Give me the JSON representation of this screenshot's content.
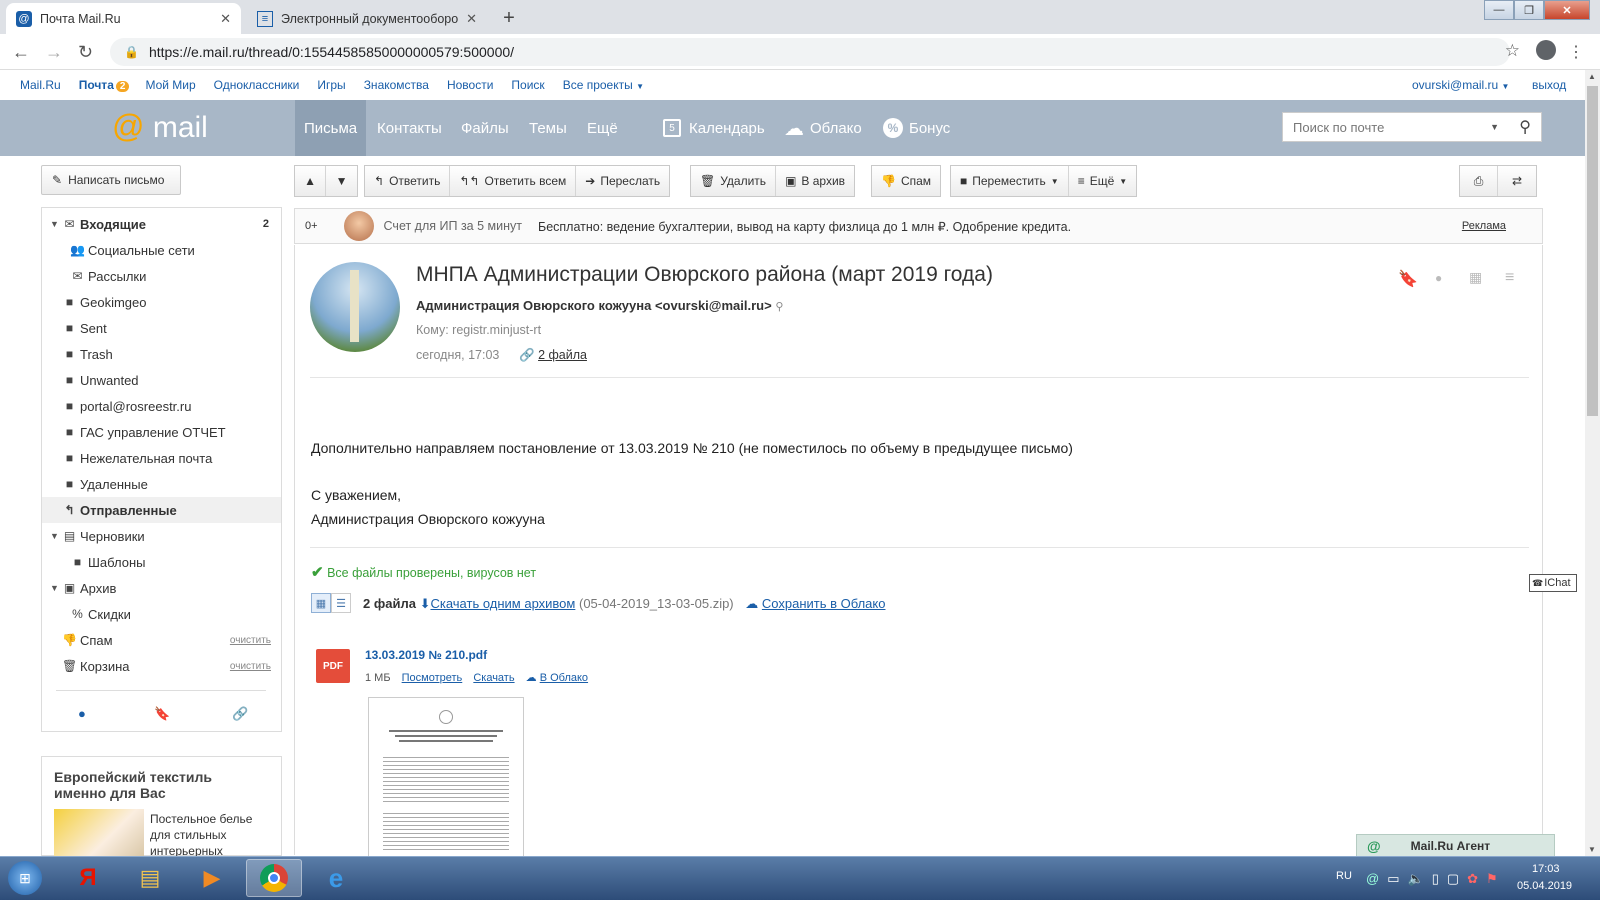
{
  "browser": {
    "tabs": [
      {
        "title": "Почта Mail.Ru",
        "active": true
      },
      {
        "title": "Электронный документооборо",
        "active": false
      }
    ],
    "new_tab": "+",
    "url": "https://e.mail.ru/thread/0:15544585850000000579:500000/"
  },
  "portal": {
    "links": [
      "Mail.Ru",
      "Почта",
      "Мой Мир",
      "Одноклассники",
      "Игры",
      "Знакомства",
      "Новости",
      "Поиск",
      "Все проекты"
    ],
    "mail_badge": "2",
    "user": "ovurski@mail.ru",
    "logout": "выход"
  },
  "header": {
    "logo": "mail",
    "nav": [
      "Письма",
      "Контакты",
      "Файлы",
      "Темы",
      "Ещё"
    ],
    "services": [
      "Календарь",
      "Облако",
      "Бонус"
    ],
    "calendar_day": "5",
    "search_placeholder": "Поиск по почте"
  },
  "compose": "Написать письмо",
  "folders": [
    {
      "name": "Входящие",
      "count": "2",
      "level": 0,
      "arrow": "▼",
      "icon": "inbox-icon"
    },
    {
      "name": "Социальные сети",
      "level": 1,
      "icon": "people-icon"
    },
    {
      "name": "Рассылки",
      "level": 1,
      "icon": "newsletter-icon"
    },
    {
      "name": "Geokimgeo",
      "level": 0,
      "icon": "folder-icon"
    },
    {
      "name": "Sent",
      "level": 0,
      "icon": "folder-icon"
    },
    {
      "name": "Trash",
      "level": 0,
      "icon": "folder-icon"
    },
    {
      "name": "Unwanted",
      "level": 0,
      "icon": "folder-icon"
    },
    {
      "name": "portal@rosreestr.ru",
      "level": 0,
      "icon": "folder-icon"
    },
    {
      "name": "ГАС управление ОТЧЕТ",
      "level": 0,
      "icon": "folder-icon"
    },
    {
      "name": "Нежелательная почта",
      "level": 0,
      "icon": "folder-icon"
    },
    {
      "name": "Удаленные",
      "level": 0,
      "icon": "folder-icon"
    },
    {
      "name": "Отправленные",
      "level": 0,
      "icon": "sent-icon",
      "selected": true
    },
    {
      "name": "Черновики",
      "level": 0,
      "arrow": "▼",
      "icon": "drafts-icon"
    },
    {
      "name": "Шаблоны",
      "level": 1,
      "icon": "folder-icon"
    },
    {
      "name": "Архив",
      "level": 0,
      "arrow": "▼",
      "icon": "archive-icon"
    },
    {
      "name": "Скидки",
      "level": 1,
      "icon": "discount-icon"
    },
    {
      "name": "Спам",
      "level": 0,
      "icon": "spam-icon",
      "clear": "очистить"
    },
    {
      "name": "Корзина",
      "level": 0,
      "icon": "trash-icon",
      "clear": "очистить"
    }
  ],
  "left_ad": {
    "title": "Европейский текстиль именно для Вас",
    "text": "Постельное белье для стильных интерьерных"
  },
  "toolbar": {
    "reply": "Ответить",
    "reply_all": "Ответить всем",
    "forward": "Переслать",
    "delete": "Удалить",
    "archive": "В архив",
    "spam": "Спам",
    "move": "Переместить",
    "more": "Ещё"
  },
  "ad_bar": {
    "age": "0+",
    "title": "Счет для ИП за 5 минут",
    "text": "Бесплатно: ведение бухгалтерии, вывод на карту физлица до 1 млн ₽. Одобрение кредита.",
    "label": "Реклама"
  },
  "message": {
    "subject": "МНПА Администрации Овюрского района (март 2019 года)",
    "from": "Администрация Овюрского кожууна <ovurski@mail.ru>",
    "to": "Кому: registr.minjust-rt",
    "date": "сегодня, 17:03",
    "files_link": "2 файла",
    "body1": "Дополнительно направляем постановление от 13.03.2019 № 210 (не поместилось по объему в предыдущее письмо)",
    "body2": "С уважением,",
    "body3": "Администрация Овюрского кожууна",
    "virus": "Все файлы проверены, вирусов нет",
    "files_count": "2 файла",
    "download_archive": "Скачать одним архивом",
    "archive_name": "(05-04-2019_13-03-05.zip)",
    "save_cloud": "Сохранить в Облако",
    "attachment": {
      "name": "13.03.2019 № 210.pdf",
      "type": "PDF",
      "size": "1 МБ",
      "view": "Посмотреть",
      "download": "Скачать",
      "cloud": "В Облако"
    }
  },
  "chat_label": "IChat",
  "agent": "Mail.Ru Агент",
  "taskbar": {
    "lang": "RU",
    "time": "17:03",
    "date": "05.04.2019"
  },
  "colors": {
    "header_bg": "#a8b7c7",
    "link": "#1a5ea8",
    "logo_at": "#f7a600",
    "ok_green": "#3aa03a",
    "pdf_red": "#e44d3a"
  }
}
